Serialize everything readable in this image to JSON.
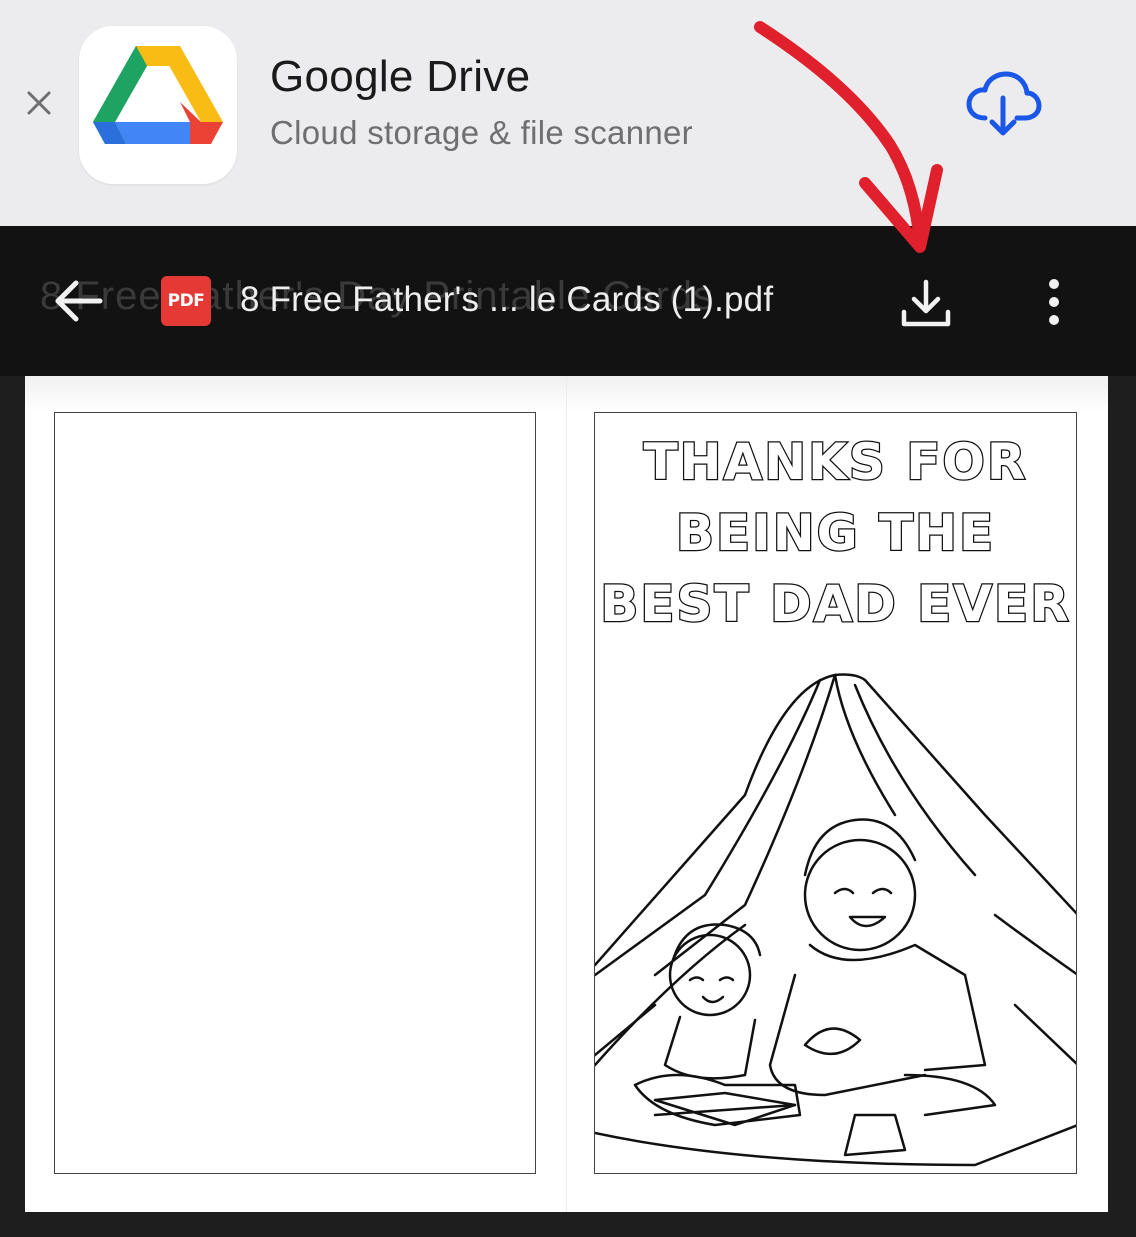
{
  "banner": {
    "app_name": "Google Drive",
    "app_subtitle": "Cloud storage & file scanner"
  },
  "toolbar": {
    "ghost_text": "8 Free Father's Day Printable Cards",
    "pdf_badge": "PDF",
    "file_name": "8 Free Father's ... le Cards (1).pdf"
  },
  "card": {
    "lines": [
      "THANKS FOR",
      "BEING THE",
      "BEST DAD EVER"
    ]
  },
  "colors": {
    "banner_bg": "#ececee",
    "toolbar_bg": "#121212",
    "pdf_badge": "#e53935",
    "cloud_icon": "#1a56e8",
    "annotation_arrow": "#e0202c"
  },
  "icons": {
    "close": "close-icon",
    "app_logo": "google-drive-logo",
    "cloud_download": "cloud-download-icon",
    "back": "arrow-left-icon",
    "download": "download-icon",
    "more": "more-vertical-icon",
    "annotation": "red-arrow-annotation"
  }
}
